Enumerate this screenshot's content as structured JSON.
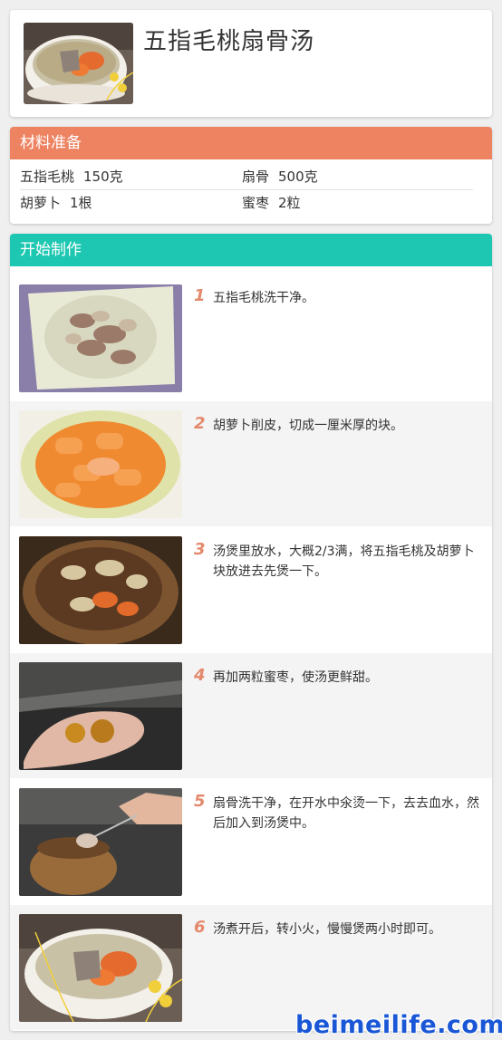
{
  "recipe": {
    "title": "五指毛桃扇骨汤"
  },
  "colors": {
    "ingredients_header": "#ee8362",
    "steps_header": "#1ec7b1",
    "step_number": "#e4896c"
  },
  "ingredients": {
    "header": "材料准备",
    "items": [
      {
        "name": "五指毛桃",
        "amount": "150克"
      },
      {
        "name": "扇骨",
        "amount": "500克"
      },
      {
        "name": "胡萝卜",
        "amount": "1根"
      },
      {
        "name": "蜜枣",
        "amount": "2粒"
      }
    ]
  },
  "steps": {
    "header": "开始制作",
    "items": [
      {
        "num": "1",
        "text": "五指毛桃洗干净。",
        "image": "dried-herbs-in-bowl"
      },
      {
        "num": "2",
        "text": "胡萝卜削皮，切成一厘米厚的块。",
        "image": "carrot-pieces-in-bowl"
      },
      {
        "num": "3",
        "text": "汤煲里放水，大概2/3满，将五指毛桃及胡萝卜块放进去先煲一下。",
        "image": "clay-pot-with-herbs"
      },
      {
        "num": "4",
        "text": "再加两粒蜜枣，使汤更鲜甜。",
        "image": "hand-holding-dates"
      },
      {
        "num": "5",
        "text": "扇骨洗干净，在开水中氽烫一下，去去血水，然后加入到汤煲中。",
        "image": "adding-bones-to-pot"
      },
      {
        "num": "6",
        "text": "汤煮开后，转小火，慢慢煲两小时即可。",
        "image": "finished-soup-bowl"
      }
    ]
  },
  "watermark": "beimeilife.com"
}
